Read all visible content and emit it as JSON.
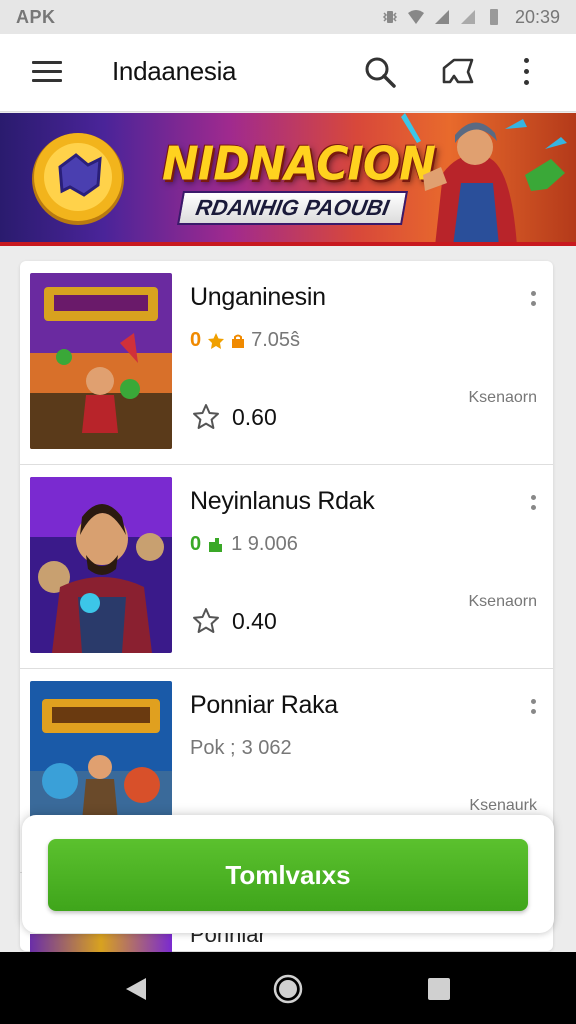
{
  "status_bar": {
    "left_text": "APK",
    "time": "20:39"
  },
  "app_bar": {
    "title": "Indaanesia"
  },
  "banner": {
    "title": "NIDNACION",
    "subtitle": "RDANHIG PAOUBI"
  },
  "games": [
    {
      "name": "Unganinesin",
      "meta_prefix": "0",
      "meta_value": "7.05ŝ",
      "rating": "0.60",
      "source": "Ksenaorn",
      "badge_color": "#f08a00"
    },
    {
      "name": "Neyinlanus Rdak",
      "meta_prefix": "0",
      "meta_value": "1 9.006",
      "rating": "0.40",
      "source": "Ksenaorn",
      "badge_color": "#3aa827"
    },
    {
      "name": "Ponniar Raka",
      "meta_prefix": "Pok ;",
      "meta_value": "3 062",
      "rating": "",
      "source": "Ksenaurk",
      "badge_color": "#777777"
    }
  ],
  "cta": {
    "label": "Tomlvaıxs"
  },
  "peek_text": "Ponniar",
  "colors": {
    "accent_green": "#46ad21",
    "banner_red": "#c8191f",
    "title_yellow": "#ffd21f"
  }
}
